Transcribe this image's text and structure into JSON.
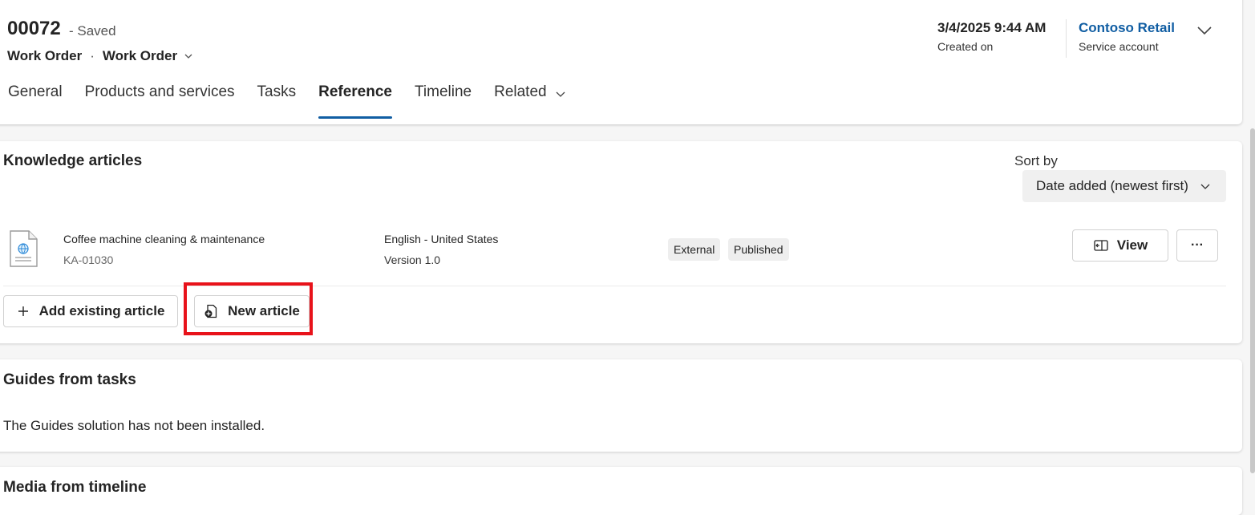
{
  "header": {
    "record_number": "00072",
    "save_status": "- Saved",
    "entity": "Work Order",
    "form_name": "Work Order",
    "created_on_value": "3/4/2025 9:44 AM",
    "created_on_label": "Created on",
    "service_account_value": "Contoso Retail",
    "service_account_label": "Service account"
  },
  "tabs": [
    {
      "label": "General"
    },
    {
      "label": "Products and services"
    },
    {
      "label": "Tasks"
    },
    {
      "label": "Reference",
      "active": true
    },
    {
      "label": "Timeline"
    },
    {
      "label": "Related"
    }
  ],
  "knowledge": {
    "title": "Knowledge articles",
    "sort_label": "Sort by",
    "sort_value": "Date added (newest first)",
    "article": {
      "title": "Coffee machine cleaning & maintenance",
      "id": "KA-01030",
      "language": "English - United States",
      "version": "Version 1.0",
      "badges": [
        "External",
        "Published"
      ],
      "view_label": "View",
      "more_label": "···"
    },
    "add_existing_label": "Add existing article",
    "new_article_label": "New article"
  },
  "guides": {
    "title": "Guides from tasks",
    "message": "The Guides solution has not been installed."
  },
  "media": {
    "title": "Media from timeline"
  },
  "colors": {
    "accent": "#115ea3",
    "highlight": "#e8121a"
  }
}
